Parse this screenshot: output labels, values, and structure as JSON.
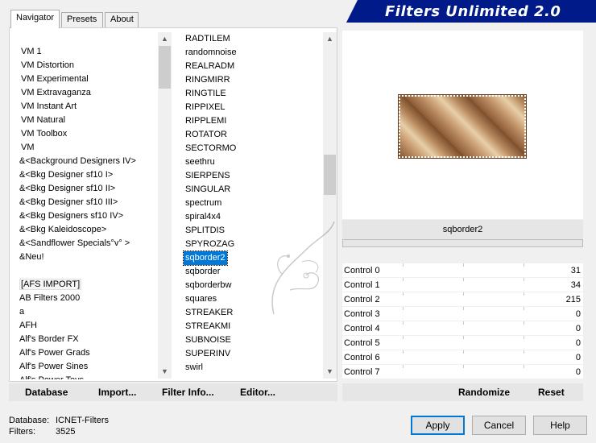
{
  "app": {
    "title": "Filters Unlimited 2.0"
  },
  "tabs": [
    {
      "label": "Navigator",
      "active": true
    },
    {
      "label": "Presets",
      "active": false
    },
    {
      "label": "About",
      "active": false
    }
  ],
  "categories": [
    "VM 1",
    "VM Distortion",
    "VM Experimental",
    "VM Extravaganza",
    "VM Instant Art",
    "VM Natural",
    "VM Toolbox",
    "VM",
    "&<Background Designers IV>",
    "&<Bkg Designer sf10 I>",
    "&<Bkg Designer sf10 II>",
    "&<Bkg Designer sf10 III>",
    "&<Bkg Designers sf10 IV>",
    "&<Bkg Kaleidoscope>",
    "&<Sandflower Specials°v° >",
    "&Neu!",
    "",
    "[AFS IMPORT]",
    "AB Filters 2000",
    "a",
    "AFH",
    "Alf's Border FX",
    "Alf's Power Grads",
    "Alf's Power Sines",
    "Alf's Power Toys"
  ],
  "filters": [
    "RADTILEM",
    "randomnoise",
    "REALRADM",
    "RINGMIRR",
    "RINGTILE",
    "RIPPIXEL",
    "RIPPLEMI",
    "ROTATOR",
    "SECTORMO",
    "seethru",
    "SIERPENS",
    "SINGULAR",
    "spectrum",
    "spiral4x4",
    "SPLITDIS",
    "SPYROZAG",
    "sqborder2",
    "sqborder",
    "sqborderbw",
    "squares",
    "STREAKER",
    "STREAKMI",
    "SUBNOISE",
    "SUPERINV",
    "swirl"
  ],
  "selected_filter": "sqborder2",
  "preview": {
    "filter_name": "sqborder2"
  },
  "controls": [
    {
      "label": "Control 0",
      "value": "31"
    },
    {
      "label": "Control 1",
      "value": "34"
    },
    {
      "label": "Control 2",
      "value": "215"
    },
    {
      "label": "Control 3",
      "value": "0"
    },
    {
      "label": "Control 4",
      "value": "0"
    },
    {
      "label": "Control 5",
      "value": "0"
    },
    {
      "label": "Control 6",
      "value": "0"
    },
    {
      "label": "Control 7",
      "value": "0"
    }
  ],
  "toolbar": {
    "database": "Database",
    "import": "Import...",
    "filter_info": "Filter Info...",
    "editor": "Editor...",
    "randomize": "Randomize",
    "reset": "Reset"
  },
  "status": {
    "database_label": "Database:",
    "database_value": "ICNET-Filters",
    "filters_label": "Filters:",
    "filters_value": "3525"
  },
  "buttons": {
    "apply": "Apply",
    "cancel": "Cancel",
    "help": "Help"
  },
  "colors": {
    "banner": "#001a8a",
    "selection": "#0078d7",
    "swatch": "#b88a5f"
  }
}
